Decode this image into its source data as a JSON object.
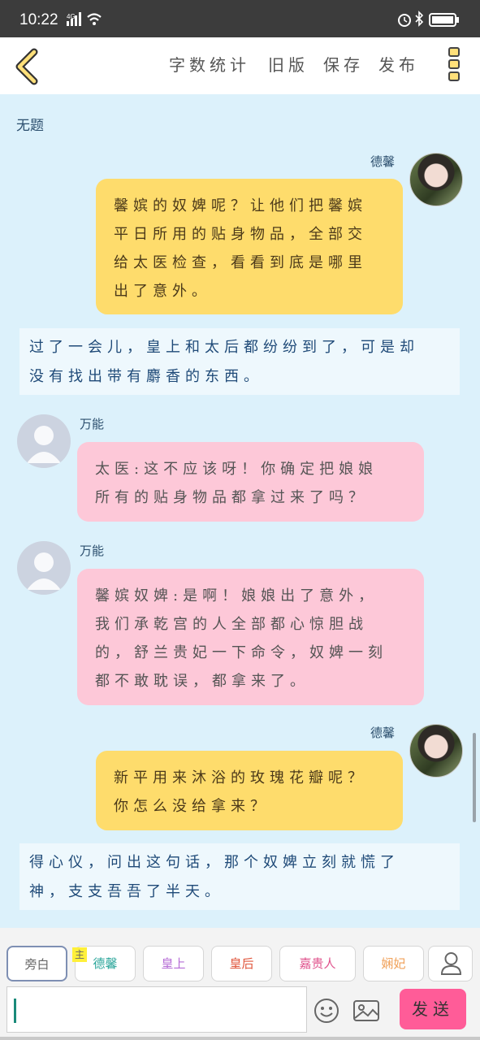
{
  "status_bar": {
    "time": "10:22",
    "network": "4G"
  },
  "toolbar": {
    "actions": [
      "字数统计",
      "旧版",
      "保存",
      "发布"
    ]
  },
  "chat": {
    "title": "无题",
    "messages": [
      {
        "type": "right",
        "speaker": "德馨",
        "text_lines": [
          "馨嫔的奴婢呢？让他们把馨嫔",
          "平日所用的贴身物品，全部交",
          "给太医检查，看看到底是哪里",
          "出了意外。"
        ]
      },
      {
        "type": "narration",
        "text_lines": [
          "过了一会儿，皇上和太后都纷纷到了，可是却",
          "没有找出带有麝香的东西。"
        ]
      },
      {
        "type": "left",
        "speaker": "万能",
        "text_lines": [
          "太医:这不应该呀！你确定把娘娘",
          "所有的贴身物品都拿过来了吗？"
        ]
      },
      {
        "type": "left",
        "speaker": "万能",
        "text_lines": [
          "馨嫔奴婢:是啊！娘娘出了意外，",
          "我们承乾宫的人全部都心惊胆战",
          "的，舒兰贵妃一下命令，奴婢一刻",
          "都不敢耽误，都拿来了。"
        ]
      },
      {
        "type": "right",
        "speaker": "德馨",
        "text_lines": [
          "新平用来沐浴的玫瑰花瓣呢？",
          "你怎么没给拿来？"
        ]
      },
      {
        "type": "narration",
        "text_lines": [
          "得心仪，问出这句话，那个奴婢立刻就慌了",
          "神，支支吾吾了半天。"
        ]
      }
    ]
  },
  "roles": [
    {
      "label": "旁白",
      "color": "#666666"
    },
    {
      "label": "德馨",
      "color": "#2aa59a",
      "tag": "主"
    },
    {
      "label": "皇上",
      "color": "#b56cd6"
    },
    {
      "label": "皇后",
      "color": "#e0553b"
    },
    {
      "label": "嘉贵人",
      "color": "#e0558e"
    },
    {
      "label": "娴妃",
      "color": "#f0a058"
    }
  ],
  "input": {
    "placeholder": ""
  },
  "send_label": "发送"
}
